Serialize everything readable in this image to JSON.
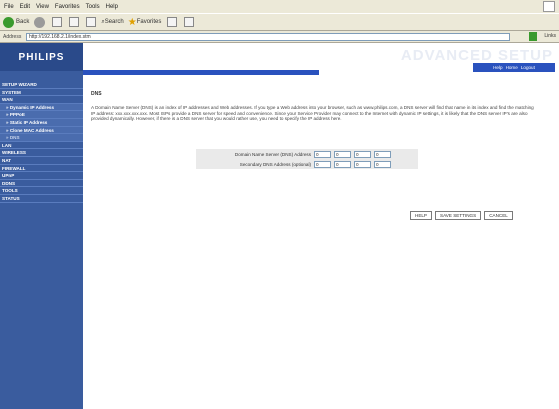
{
  "browser": {
    "menu": [
      "File",
      "Edit",
      "View",
      "Favorites",
      "Tools",
      "Help"
    ],
    "toolbar": {
      "back_label": "Back",
      "search_label": "Search",
      "favorites_label": "Favorites"
    },
    "address_label": "Address",
    "address_value": "http://192.168.2.1/index.stm",
    "go_label": "Go",
    "links_label": "Links"
  },
  "brand": {
    "logo": "PHILIPS",
    "banner": "ADVANCED SETUP",
    "help_label": "Help",
    "home_label": "Home",
    "logout_label": "Logout"
  },
  "sidebar": {
    "items": [
      {
        "label": "SETUP WIZARD",
        "type": "main"
      },
      {
        "label": "SYSTEM",
        "type": "main"
      },
      {
        "label": "WAN",
        "type": "main"
      },
      {
        "label": "» Dynamic IP Address",
        "type": "sub"
      },
      {
        "label": "» PPPoE",
        "type": "sub"
      },
      {
        "label": "» Static IP Address",
        "type": "sub"
      },
      {
        "label": "» Clone MAC Address",
        "type": "sub"
      },
      {
        "label": "» DNS",
        "type": "sub"
      },
      {
        "label": "LAN",
        "type": "main"
      },
      {
        "label": "WIRELESS",
        "type": "main"
      },
      {
        "label": "NAT",
        "type": "main"
      },
      {
        "label": "FIREWALL",
        "type": "main"
      },
      {
        "label": "UPnP",
        "type": "main"
      },
      {
        "label": "DDNS",
        "type": "main"
      },
      {
        "label": "TOOLS",
        "type": "main"
      },
      {
        "label": "STATUS",
        "type": "main"
      }
    ]
  },
  "main": {
    "section_title": "DNS",
    "description": "A Domain Name Server (DNS) is an index of IP addresses and Web addresses. If you type a Web address into your browser, such as www.philips.com, a DNS server will find that name in its index and find the matching IP address: xxx.xxx.xxx.xxx. Most ISPs provide a DNS server for speed and convenience. Since your Service Provider may connect to the Internet with dynamic IP settings, it is likely that the DNS server IP's are also provided dynamically. However, if there is a DNS server that you would rather use, you need to specify the IP address here.",
    "fields": [
      {
        "label": "Domain Name Server (DNS) Address",
        "values": [
          "0",
          "0",
          "0",
          "0"
        ]
      },
      {
        "label": "Secondary DNS Address (optional)",
        "values": [
          "0",
          "0",
          "0",
          "0"
        ]
      }
    ],
    "buttons": {
      "help": "HELP",
      "save": "SAVE SETTINGS",
      "cancel": "CANCEL"
    }
  }
}
